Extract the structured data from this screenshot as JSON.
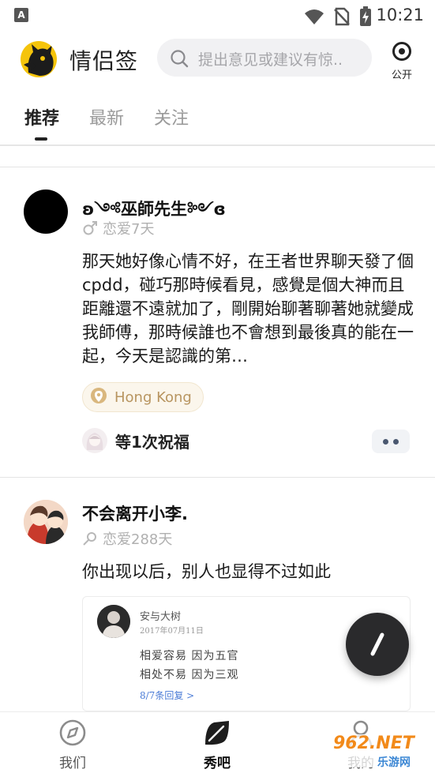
{
  "status_bar": {
    "time": "10:21",
    "notification_letter": "A"
  },
  "header": {
    "app_title": "情侣签",
    "search": {
      "placeholder": "提出意见或建议有惊.."
    },
    "public_label": "公开"
  },
  "tabs": [
    {
      "label": "推荐",
      "active": true
    },
    {
      "label": "最新",
      "active": false
    },
    {
      "label": "关注",
      "active": false
    }
  ],
  "posts": [
    {
      "username": "ʚ༺巫師先生༻ɞ",
      "gender_icon": "male-icon",
      "love_days": "恋爱7天",
      "content": "那天她好像心情不好，在王者世界聊天發了個cpdd，碰巧那時候看見，感覺是個大神而且距離還不遠就加了，剛開始聊著聊著她就變成我師傅，那時候誰也不會想到最後真的能在一起，今天是認識的第…",
      "location": "Hong Kong",
      "blessing": "等1次祝福"
    },
    {
      "username": "不会离开小李.",
      "gender_icon": "pin-icon",
      "love_days": "恋爱288天",
      "content": "你出现以后，别人也显得不过如此",
      "quote": {
        "name": "安与大树",
        "date": "2017年07月11日",
        "lines": [
          "相爱容易  因为五官",
          "相处不易  因为三观"
        ],
        "reply": "8/7条回复 >"
      }
    }
  ],
  "bottom_nav": [
    {
      "label": "我们",
      "icon": "compass-icon",
      "active": false
    },
    {
      "label": "秀吧",
      "icon": "leaf-icon",
      "active": true
    },
    {
      "label": "我的",
      "icon": "profile-icon",
      "active": false
    }
  ],
  "watermark": {
    "text": "962.NET",
    "sub": "乐游网"
  },
  "colors": {
    "brand_yellow": "#f5c40b",
    "fab": "#2a2a2c",
    "location_text": "#b89560"
  }
}
